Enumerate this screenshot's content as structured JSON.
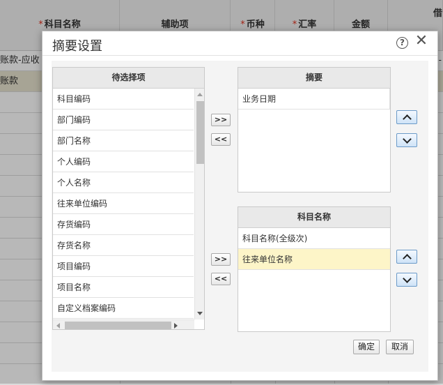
{
  "background": {
    "columns": [
      {
        "label": "科目名称",
        "required": true
      },
      {
        "label": "辅助项",
        "required": false
      },
      {
        "label": "币种",
        "required": true
      },
      {
        "label": "汇率",
        "required": true
      },
      {
        "label": "金额",
        "required": false
      },
      {
        "label": "借",
        "required": false
      }
    ],
    "required_mark": "*",
    "rows": [
      "账款-应收",
      "账款"
    ],
    "right_edge_glyph": "-"
  },
  "dialog": {
    "title": "摘要设置",
    "help_glyph": "?",
    "close_glyph": "✕",
    "available": {
      "header": "待选择项",
      "items": [
        "科目编码",
        "部门编码",
        "部门名称",
        "个人编码",
        "个人名称",
        "往来单位编码",
        "存货编码",
        "存货名称",
        "项目编码",
        "项目名称",
        "自定义档案编码"
      ]
    },
    "summary": {
      "header": "摘要",
      "items": [
        "业务日期"
      ]
    },
    "subject": {
      "header": "科目名称",
      "items": [
        "科目名称(全级次)",
        "往来单位名称"
      ],
      "selected_index": 1
    },
    "buttons": {
      "move_right": ">>",
      "move_left": "<<",
      "confirm": "确定",
      "cancel": "取消"
    }
  },
  "colors": {
    "selected_row": "#fdf5c8",
    "order_button_border": "#6b9ac8",
    "required_mark": "#e0301e"
  }
}
